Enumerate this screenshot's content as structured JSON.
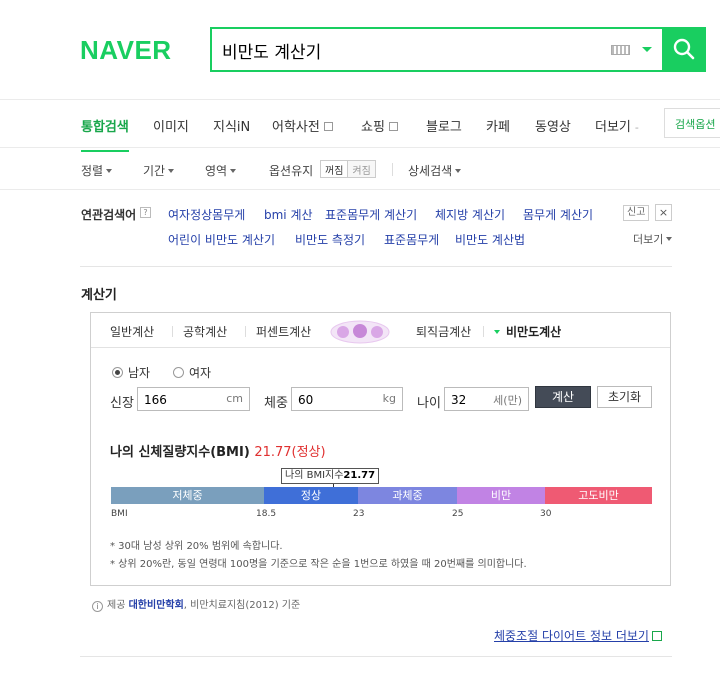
{
  "header": {
    "logo": "NAVER",
    "query": "비만도 계산기"
  },
  "tabs": [
    {
      "label": "통합검색",
      "active": true
    },
    {
      "label": "이미지"
    },
    {
      "label": "지식iN"
    },
    {
      "label": "어학사전"
    },
    {
      "label": "쇼핑"
    },
    {
      "label": "블로그"
    },
    {
      "label": "카페"
    },
    {
      "label": "동영상"
    },
    {
      "label": "더보기"
    }
  ],
  "tab_option": "검색옵션",
  "filters": {
    "sort": "정렬",
    "period": "기간",
    "area": "영역",
    "keep_option": "옵션유지",
    "off": "꺼짐",
    "on": "켜짐",
    "detail": "상세검색"
  },
  "related": {
    "label": "연관검색어",
    "help": "?",
    "row1": [
      "여자정상몸무게",
      "bmi 계산",
      "표준몸무게 계산기",
      "체지방 계산기",
      "몸무게 계산기"
    ],
    "row2": [
      "어린이 비만도 계산기",
      "비만도 측정기",
      "표준몸무게",
      "비만도 계산법"
    ],
    "report": "신고",
    "close": "×",
    "more": "더보기"
  },
  "calculator": {
    "title": "계산기",
    "tabs": [
      "일반계산",
      "공학계산",
      "퍼센트계산",
      "퇴직금계산",
      "비만도계산"
    ],
    "gender_male": "남자",
    "gender_female": "여자",
    "height_label": "신장",
    "height_value": "166",
    "height_unit": "cm",
    "weight_label": "체중",
    "weight_value": "60",
    "weight_unit": "kg",
    "age_label": "나이",
    "age_value": "32",
    "age_unit": "세(만)",
    "calc_button": "계산",
    "reset_button": "초기화",
    "result_label": "나의 신체질량지수(BMI)",
    "result_value": "21.77(정상)",
    "marker_prefix": "나의 BMI지수",
    "marker_value": "21.77",
    "segments": [
      {
        "label": "저체중",
        "color": "#7a9fbd"
      },
      {
        "label": "정상",
        "color": "#3f6fd8"
      },
      {
        "label": "과체중",
        "color": "#7d86e0"
      },
      {
        "label": "비만",
        "color": "#c183e4"
      },
      {
        "label": "고도비만",
        "color": "#ef5a73"
      }
    ],
    "ticks": [
      "BMI",
      "18.5",
      "23",
      "25",
      "30"
    ],
    "note1": "* 30대 남성 상위 20% 범위에 속합니다.",
    "note2": "* 상위 20%란, 동일 연령대 100명을 기준으로 작은 순을 1번으로 하였을 때 20번째를 의미합니다."
  },
  "source": {
    "prefix": "제공",
    "org": "대한비만학회",
    "suffix": ", 비만치료지침(2012) 기준"
  },
  "bottom_link": "체중조절 다이어트 정보 더보기"
}
